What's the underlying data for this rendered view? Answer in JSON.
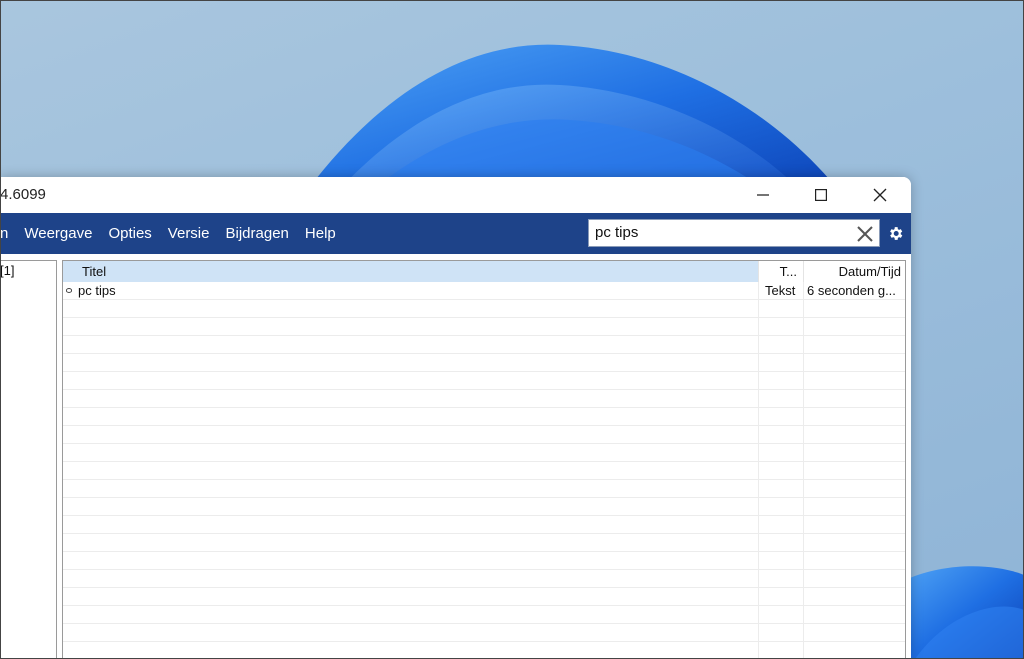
{
  "window": {
    "title": "4.6099",
    "controls": [
      "minimize",
      "maximize",
      "close"
    ]
  },
  "menu": {
    "items": [
      "n",
      "Weergave",
      "Opties",
      "Versie",
      "Bijdragen",
      "Help"
    ]
  },
  "search": {
    "value": "pc tips"
  },
  "sidebar": {
    "text": "[1]"
  },
  "list": {
    "columns": [
      "Titel",
      "T...",
      "Datum/Tijd"
    ],
    "rows": [
      {
        "title": "pc tips",
        "type": "Tekst",
        "date": "6 seconden g..."
      }
    ],
    "empty_rows": 20
  },
  "colors": {
    "menubar": "#1e4389",
    "header_highlight": "#cfe3f6",
    "wallpaper_blue": "#1a6fe0"
  },
  "icons": [
    "minimize-icon",
    "maximize-icon",
    "close-icon",
    "search-clear-icon",
    "gear-icon",
    "row-item-icon"
  ]
}
